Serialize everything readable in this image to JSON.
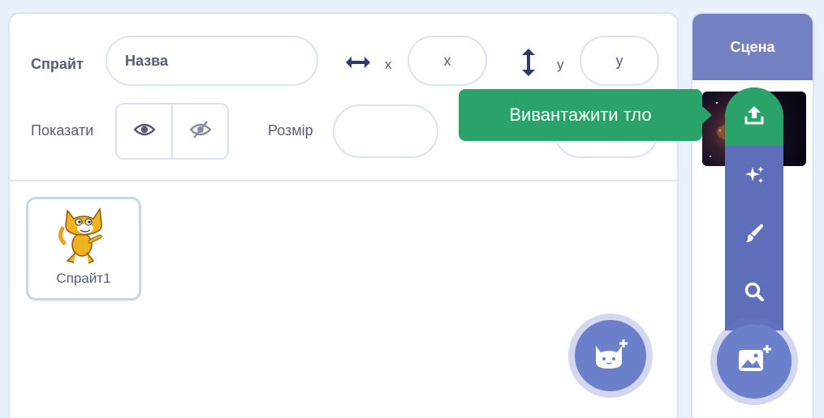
{
  "sprite_info": {
    "sprite_label": "Спрайт",
    "name_placeholder": "Назва",
    "x_axis_label": "x",
    "x_placeholder": "x",
    "y_axis_label": "y",
    "y_placeholder": "y",
    "show_label": "Показати",
    "size_label": "Розмір",
    "size_value": "",
    "direction_value": ""
  },
  "sprites": [
    {
      "name": "Спрайт1"
    }
  ],
  "stage": {
    "header": "Сцена"
  },
  "backdrop_menu": {
    "tooltip": "Вивантажити тло",
    "items": [
      "upload-icon",
      "surprise-icon",
      "paint-icon",
      "search-icon"
    ],
    "main_button_icon": "add-backdrop-icon"
  },
  "sprite_add_button_icon": "add-sprite-cat-icon",
  "colors": {
    "accent_green": "#29a36a",
    "menu_blue": "#5f6eb8",
    "stage_header": "#7380c2",
    "text": "#575e75",
    "border": "#d9e3f2"
  }
}
